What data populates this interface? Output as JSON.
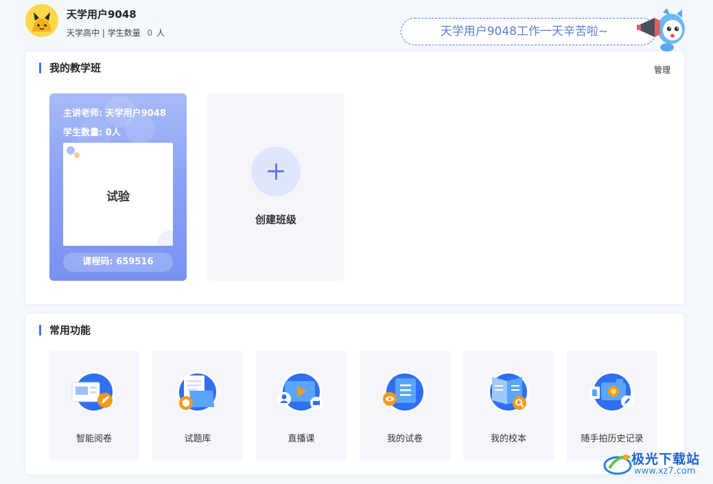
{
  "colors": {
    "accent": "#4a6cf7",
    "card_gradient_top": "#a7baf7",
    "card_gradient_bottom": "#7892f2",
    "tile_bg": "#f4f6fb"
  },
  "header": {
    "username": "天学用户9048",
    "school": "天学高中",
    "student_count_label": "| 学生数量",
    "student_count": "0",
    "student_count_unit": "人",
    "greeting": "天学用户9048工作一天辛苦啦~",
    "avatar_icon": "cat-avatar-icon",
    "mascot_icon": "megaphone-mascot-icon"
  },
  "classes_panel": {
    "title": "我的教学班",
    "manage_label": "管理",
    "classes": [
      {
        "teacher": "主讲老师: 天学用户9048",
        "student_count": "学生数量: 0人",
        "name": "试验",
        "course_code": "课程码: 659516"
      }
    ],
    "create_label": "创建班级",
    "create_icon": "plus-icon"
  },
  "functions_panel": {
    "title": "常用功能",
    "items": [
      {
        "label": "智能阅卷",
        "icon": "smart-grading-icon"
      },
      {
        "label": "试题库",
        "icon": "question-bank-icon"
      },
      {
        "label": "直播课",
        "icon": "live-class-icon"
      },
      {
        "label": "我的试卷",
        "icon": "my-papers-icon"
      },
      {
        "label": "我的校本",
        "icon": "school-book-icon"
      },
      {
        "label": "随手拍历史记录",
        "icon": "photo-history-icon"
      }
    ]
  },
  "watermark": {
    "title": "极光下载站",
    "url": "www.xz7.com"
  }
}
